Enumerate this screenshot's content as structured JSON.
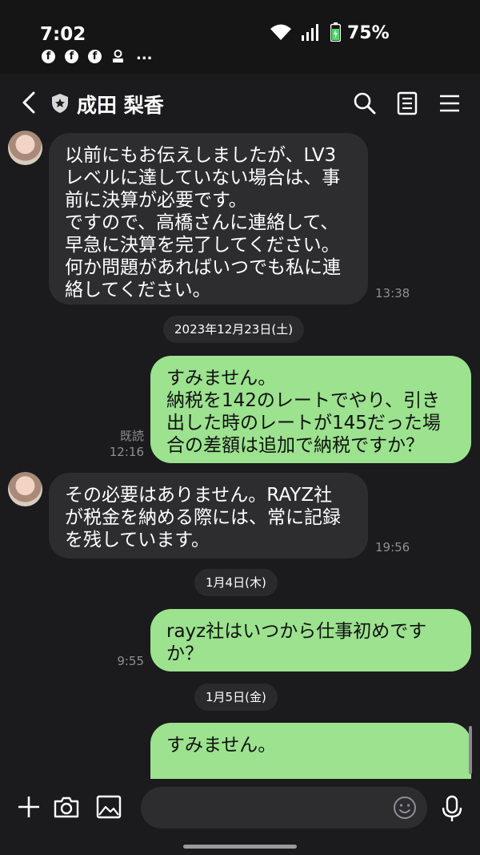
{
  "status_bar": {
    "time": "7:02",
    "battery": "75%",
    "notification_icons": [
      "facebook-icon",
      "facebook-icon",
      "facebook-icon",
      "app-notification-icon"
    ],
    "more": "..."
  },
  "header": {
    "title": "成田 梨香",
    "icons": [
      "back-icon",
      "shield-icon",
      "search-icon",
      "notes-icon",
      "menu-icon"
    ]
  },
  "messages": [
    {
      "type": "incoming",
      "text": "以前にもお伝えしましたが、LV3\nレベルに達していない場合は、事\n前に決算が必要です。\nですので、高橋さんに連絡して、\n早急に決算を完了してください。\n何か問題があればいつでも私に連\n絡してください。",
      "time": "13:38"
    },
    {
      "type": "date",
      "text": "2023年12月23日(土)"
    },
    {
      "type": "outgoing",
      "text": "すみません。\n納税を142のレートでやり、引き\n出した時のレートが145だった場\n合の差額は追加で納税ですか？",
      "read": "既読",
      "time": "12:16"
    },
    {
      "type": "incoming",
      "text": "その必要はありません。RAYZ社\nが税金を納める際には、常に記録\nを残しています。",
      "time": "19:56"
    },
    {
      "type": "date",
      "text": "1月4日(木)"
    },
    {
      "type": "outgoing",
      "text": "rayz社はいつから仕事初めです\nか？",
      "time": "9:55"
    },
    {
      "type": "date",
      "text": "1月5日(金)"
    },
    {
      "type": "outgoing",
      "text": "すみません。",
      "time": ""
    }
  ],
  "input_bar": {
    "icons": [
      "plus-icon",
      "camera-icon",
      "image-icon",
      "emoji-icon",
      "mic-icon"
    ],
    "placeholder": ""
  },
  "colors": {
    "background": "#1b1b1d",
    "incoming_bubble": "#2d2d30",
    "outgoing_bubble": "#9ce28f",
    "timestamp": "#8e8e93"
  }
}
